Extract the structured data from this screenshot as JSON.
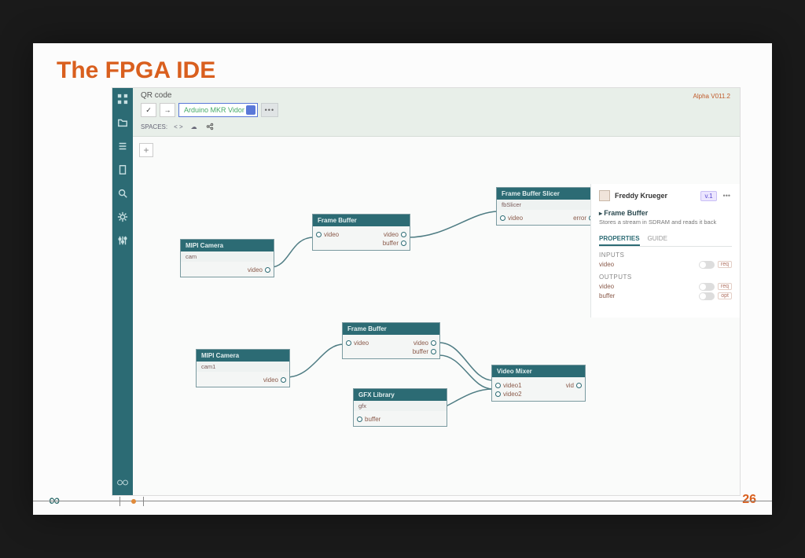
{
  "slide": {
    "title": "The FPGA IDE",
    "title_color": "#d95f1e",
    "page_number": "26",
    "page_number_color": "#d95f1e"
  },
  "ide": {
    "project_name": "QR code",
    "alpha_label": "Alpha V011.2",
    "board_selector": "Arduino MKR Vidor",
    "spaces_label": "SPACES:",
    "spaces_brackets": "< >",
    "plus_label": "+"
  },
  "rail_icons": [
    "grid-icon",
    "folder-icon",
    "list-icon",
    "clipboard-icon",
    "search-icon",
    "gear-icon",
    "sliders-icon"
  ],
  "nodes": {
    "cam1": {
      "title": "MIPI Camera",
      "sub": "cam",
      "outputs": [
        "video"
      ]
    },
    "fb1": {
      "title": "Frame Buffer",
      "inputs": [
        "video"
      ],
      "outputs": [
        "video",
        "buffer"
      ]
    },
    "slicer": {
      "title": "Frame Buffer Slicer",
      "sub": "fbSlicer",
      "inputs": [
        "video"
      ],
      "outputs": [
        "error"
      ]
    },
    "cam2": {
      "title": "MIPI Camera",
      "sub": "cam1",
      "outputs": [
        "video"
      ]
    },
    "fb2": {
      "title": "Frame Buffer",
      "inputs": [
        "video"
      ],
      "outputs": [
        "video",
        "buffer"
      ]
    },
    "gfx": {
      "title": "GFX Library",
      "sub": "gfx",
      "outputs": [
        "buffer"
      ]
    },
    "mixer": {
      "title": "Video Mixer",
      "inputs": [
        "video1",
        "video2"
      ],
      "outputs": [
        "vid"
      ]
    }
  },
  "inspector": {
    "user": "Freddy Krueger",
    "version": "v.1",
    "section_title": "Frame Buffer",
    "description": "Stores a stream in SDRAM and reads it back",
    "tabs": {
      "properties": "PROPERTIES",
      "guide": "GUIDE"
    },
    "inputs_label": "INPUTS",
    "outputs_label": "OUTPUTS",
    "inputs": [
      {
        "name": "video",
        "badge": "req"
      }
    ],
    "outputs": [
      {
        "name": "video",
        "badge": "req"
      },
      {
        "name": "buffer",
        "badge": "opt"
      }
    ]
  }
}
